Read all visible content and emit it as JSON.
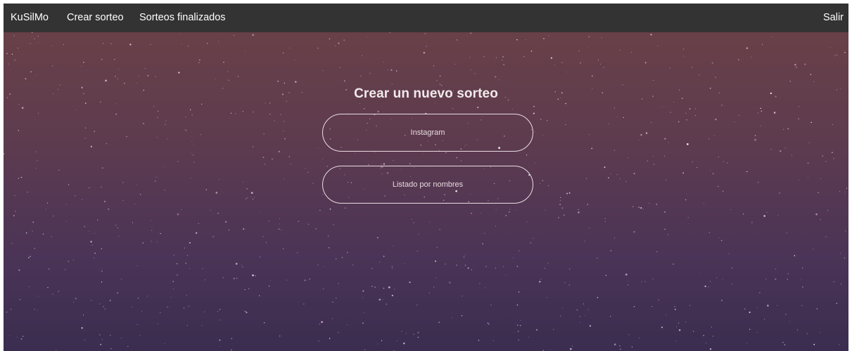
{
  "navbar": {
    "brand": "KuSilMo",
    "crear": "Crear sorteo",
    "finalizados": "Sorteos finalizados",
    "salir": "Salir"
  },
  "main": {
    "title": "Crear un nuevo sorteo",
    "options": {
      "instagram": "Instagram",
      "listado": "Listado por nombres"
    }
  },
  "colors": {
    "navbar_bg": "#333333",
    "hero_top": "#684048",
    "hero_bottom": "#3a2d4f",
    "pill_border": "#e9dde1"
  }
}
